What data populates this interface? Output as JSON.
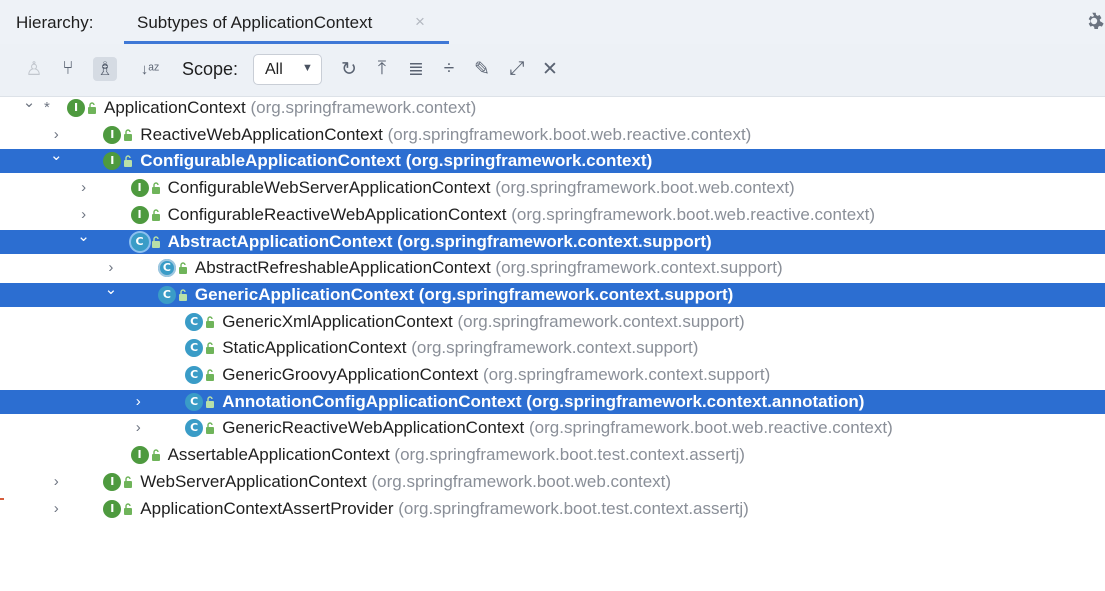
{
  "header": {
    "label": "Hierarchy:",
    "tab_title": "Subtypes of ApplicationContext",
    "tab_close": "×",
    "settings_icon": "gear-icon"
  },
  "toolbar": {
    "scope_label": "Scope:",
    "scope_value": "All",
    "icons": [
      "supertypes-icon",
      "subtypes-icon",
      "class-hierarchy-icon",
      "sort-alphabetically-icon",
      "refresh-icon",
      "autoscroll-from-source-icon",
      "expand-all-icon",
      "collapse-all-icon",
      "pin-icon",
      "open-in-window-icon",
      "close-icon"
    ]
  },
  "colors": {
    "selection": "#2c6ed1",
    "interface_icon": "#4e9a3f",
    "class_icon": "#3a9cc7",
    "package_text": "#8a8f98"
  },
  "tree": [
    {
      "level": 0,
      "toggle": "expanded",
      "star": true,
      "kind": "interface",
      "name": "ApplicationContext",
      "pkg": "(org.springframework.context)",
      "selected": false
    },
    {
      "level": 1,
      "toggle": "collapsed",
      "kind": "interface",
      "name": "ReactiveWebApplicationContext",
      "pkg": "(org.springframework.boot.web.reactive.context)",
      "selected": false
    },
    {
      "level": 1,
      "toggle": "expanded",
      "kind": "interface",
      "name": "ConfigurableApplicationContext",
      "pkg": "(org.springframework.context)",
      "selected": true
    },
    {
      "level": 2,
      "toggle": "collapsed",
      "kind": "interface",
      "name": "ConfigurableWebServerApplicationContext",
      "pkg": "(org.springframework.boot.web.context)",
      "selected": false
    },
    {
      "level": 2,
      "toggle": "collapsed",
      "kind": "interface",
      "name": "ConfigurableReactiveWebApplicationContext",
      "pkg": "(org.springframework.boot.web.reactive.context)",
      "selected": false
    },
    {
      "level": 2,
      "toggle": "expanded",
      "kind": "abstract",
      "name": "AbstractApplicationContext",
      "pkg": "(org.springframework.context.support)",
      "selected": true
    },
    {
      "level": 3,
      "toggle": "collapsed",
      "kind": "abstract",
      "name": "AbstractRefreshableApplicationContext",
      "pkg": "(org.springframework.context.support)",
      "selected": false
    },
    {
      "level": 3,
      "toggle": "expanded",
      "kind": "class",
      "name": "GenericApplicationContext",
      "pkg": "(org.springframework.context.support)",
      "selected": true
    },
    {
      "level": 4,
      "toggle": "none",
      "kind": "class",
      "name": "GenericXmlApplicationContext",
      "pkg": "(org.springframework.context.support)",
      "selected": false
    },
    {
      "level": 4,
      "toggle": "none",
      "kind": "class",
      "name": "StaticApplicationContext",
      "pkg": "(org.springframework.context.support)",
      "selected": false
    },
    {
      "level": 4,
      "toggle": "none",
      "kind": "class",
      "name": "GenericGroovyApplicationContext",
      "pkg": "(org.springframework.context.support)",
      "selected": false
    },
    {
      "level": 4,
      "toggle": "collapsed",
      "kind": "class",
      "name": "AnnotationConfigApplicationContext",
      "pkg": "(org.springframework.context.annotation)",
      "selected": true
    },
    {
      "level": 4,
      "toggle": "collapsed",
      "kind": "class",
      "name": "GenericReactiveWebApplicationContext",
      "pkg": "(org.springframework.boot.web.reactive.context)",
      "selected": false
    },
    {
      "level": 2,
      "toggle": "none",
      "kind": "interface",
      "name": "AssertableApplicationContext",
      "pkg": "(org.springframework.boot.test.context.assertj)",
      "selected": false
    },
    {
      "level": 1,
      "toggle": "collapsed",
      "kind": "interface",
      "name": "WebServerApplicationContext",
      "pkg": "(org.springframework.boot.web.context)",
      "selected": false
    },
    {
      "level": 1,
      "toggle": "collapsed",
      "kind": "interface",
      "name": "ApplicationContextAssertProvider",
      "pkg": "(org.springframework.boot.test.context.assertj)",
      "selected": false
    }
  ]
}
